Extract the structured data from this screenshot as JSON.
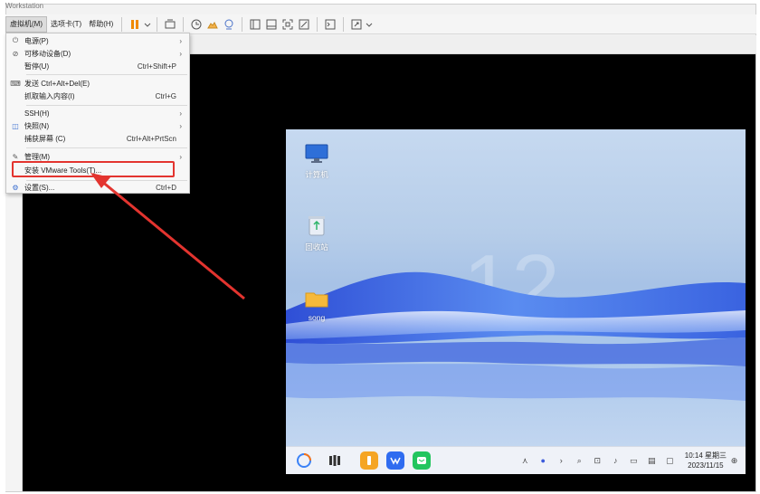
{
  "window": {
    "title": "Workstation"
  },
  "menubar": {
    "items": [
      "虚拟机(M)",
      "选项卡(T)",
      "帮助(H)"
    ]
  },
  "vm_menu": {
    "items": [
      {
        "icon": "⏻",
        "label": "电源(P)",
        "shortcut": "",
        "submenu": true
      },
      {
        "icon": "⊘",
        "label": "可移动设备(D)",
        "shortcut": "",
        "submenu": true
      },
      {
        "icon": "",
        "label": "暂停(U)",
        "shortcut": "Ctrl+Shift+P",
        "submenu": false
      },
      {
        "icon": "⌨",
        "label": "发送 Ctrl+Alt+Del(E)",
        "shortcut": "",
        "submenu": false
      },
      {
        "icon": "",
        "label": "抓取输入内容(I)",
        "shortcut": "Ctrl+G",
        "submenu": false
      },
      {
        "icon": "",
        "label": "SSH(H)",
        "shortcut": "",
        "submenu": true
      },
      {
        "icon": "◫",
        "label": "快照(N)",
        "shortcut": "",
        "submenu": true
      },
      {
        "icon": "",
        "label": "捕获屏幕 (C)",
        "shortcut": "Ctrl+Alt+PrtScn",
        "submenu": false
      },
      {
        "icon": "✎",
        "label": "管理(M)",
        "shortcut": "",
        "submenu": true
      },
      {
        "icon": "",
        "label": "安装 VMware Tools(T)...",
        "shortcut": "",
        "submenu": false
      },
      {
        "icon": "⚙",
        "label": "设置(S)...",
        "shortcut": "Ctrl+D",
        "submenu": false
      }
    ]
  },
  "desktop": {
    "icons": [
      {
        "name": "computer",
        "label": "计算机"
      },
      {
        "name": "recycle-bin",
        "label": "回收站"
      },
      {
        "name": "folder",
        "label": "song"
      }
    ]
  },
  "taskbar": {
    "time": "10:14 星期三",
    "date": "2023/11/15"
  },
  "colors": {
    "highlight": "#e3342f",
    "pause": "#f08a00"
  }
}
